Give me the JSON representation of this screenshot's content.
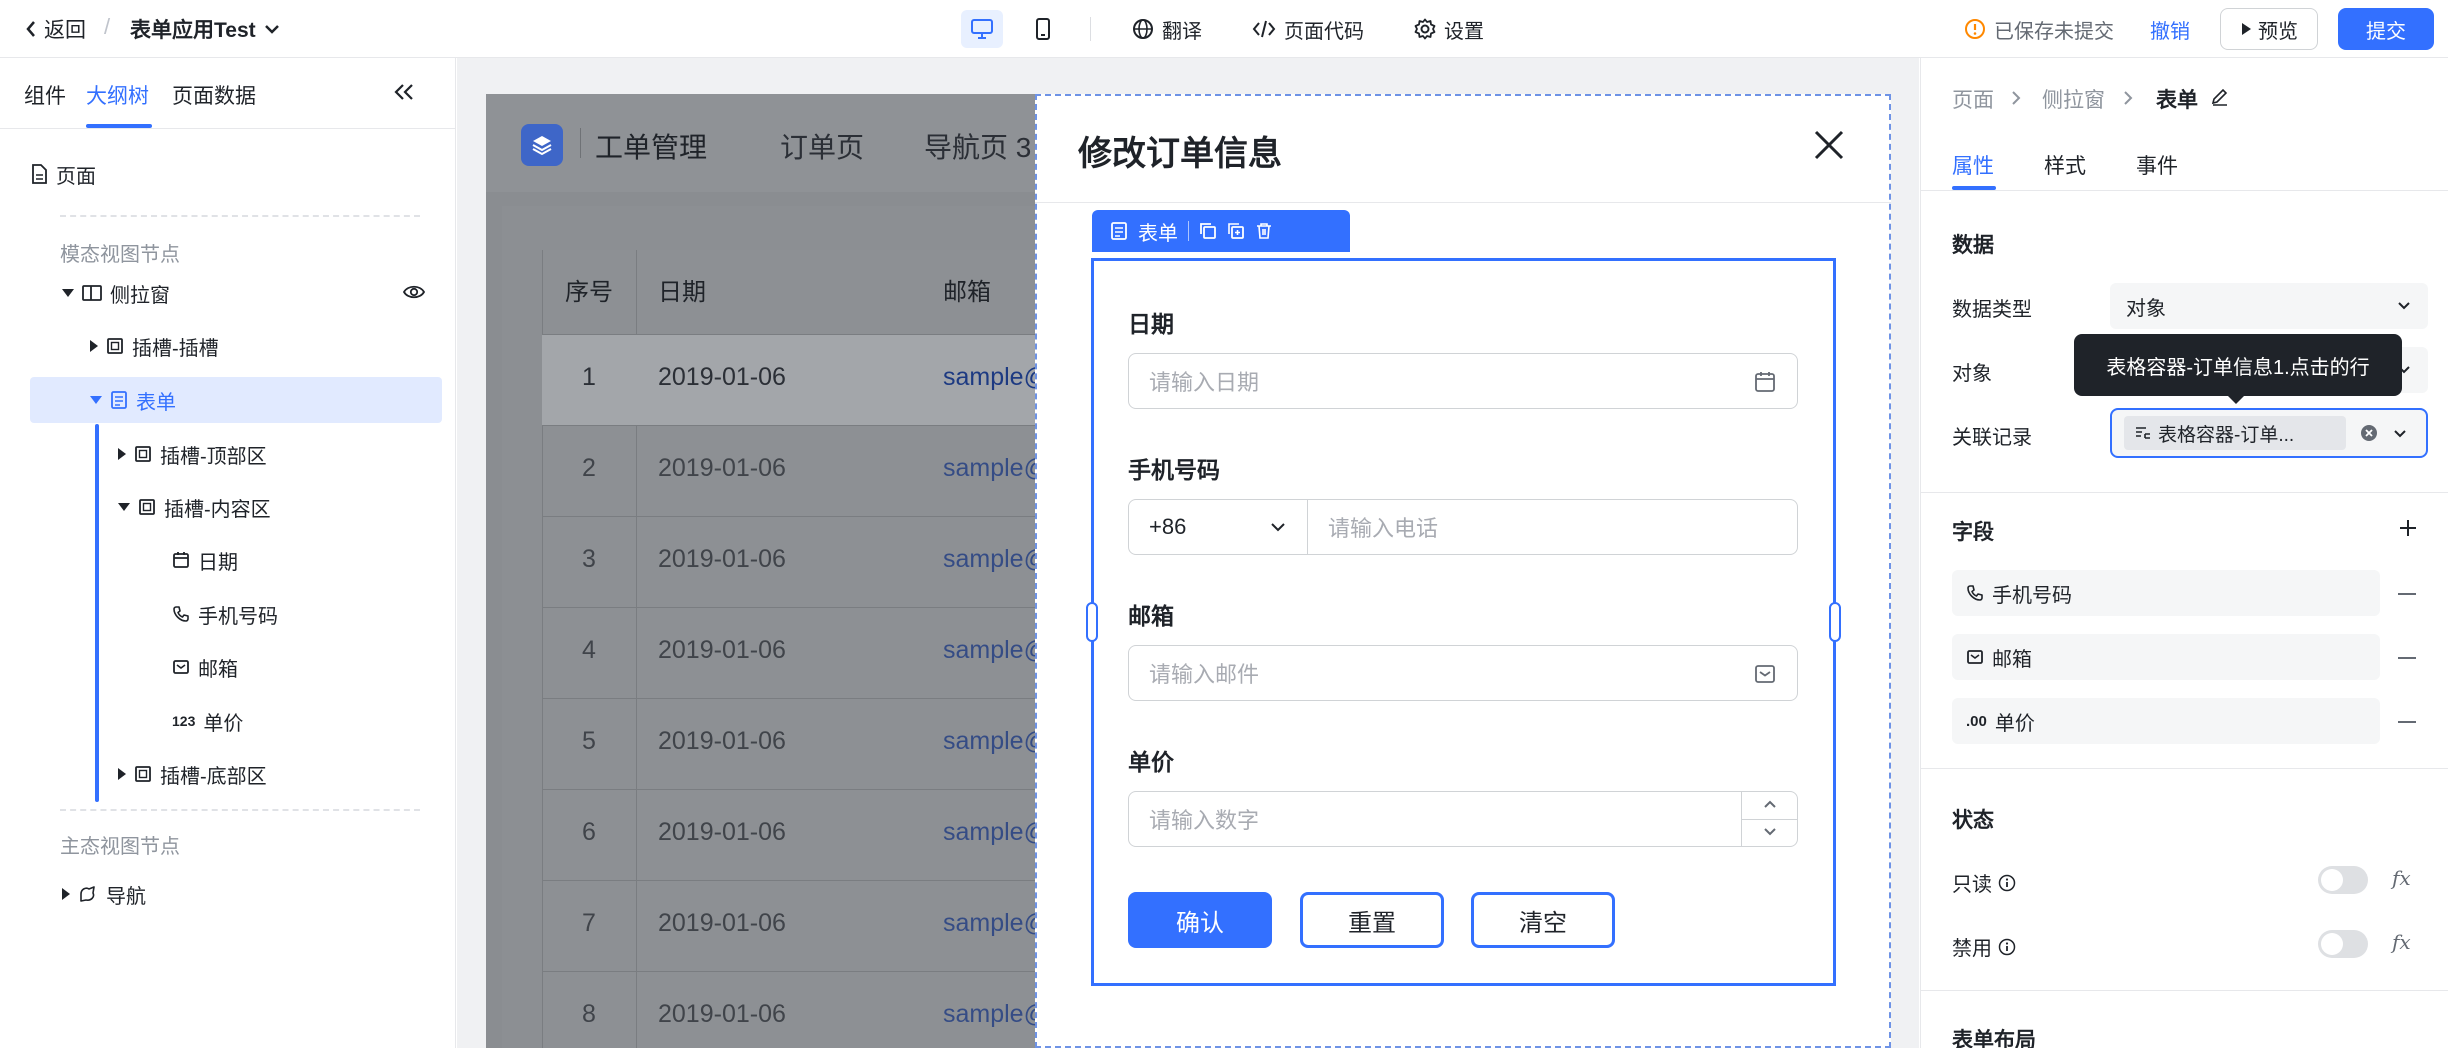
{
  "topbar": {
    "back_label": "返回",
    "separator": "/",
    "app_name": "表单应用Test",
    "tools": {
      "translate": "翻译",
      "page_code": "页面代码",
      "settings": "设置"
    },
    "status": "已保存未提交",
    "undo": "撤销",
    "preview": "预览",
    "submit": "提交"
  },
  "left": {
    "tabs": [
      "组件",
      "大纲树",
      "页面数据"
    ],
    "active_tab": "大纲树",
    "tree": {
      "page": "页面",
      "modal_section": "模态视图节点",
      "drawer": "侧拉窗",
      "slot_slot": "插槽-插槽",
      "form": "表单",
      "slot_top": "插槽-顶部区",
      "slot_content": "插槽-内容区",
      "date": "日期",
      "phone": "手机号码",
      "email": "邮箱",
      "price_prefix": "123",
      "price": "单价",
      "slot_bottom": "插槽-底部区",
      "main_section": "主态视图节点",
      "nav": "导航"
    }
  },
  "preview": {
    "app_title": "工单管理",
    "nav": [
      "订单页",
      "导航页 3"
    ],
    "columns": [
      "序号",
      "日期",
      "邮箱"
    ],
    "rows": [
      {
        "idx": "1",
        "date": "2019-01-06",
        "email": "sample@"
      },
      {
        "idx": "2",
        "date": "2019-01-06",
        "email": "sample@"
      },
      {
        "idx": "3",
        "date": "2019-01-06",
        "email": "sample@"
      },
      {
        "idx": "4",
        "date": "2019-01-06",
        "email": "sample@"
      },
      {
        "idx": "5",
        "date": "2019-01-06",
        "email": "sample@"
      },
      {
        "idx": "6",
        "date": "2019-01-06",
        "email": "sample@"
      },
      {
        "idx": "7",
        "date": "2019-01-06",
        "email": "sample@"
      },
      {
        "idx": "8",
        "date": "2019-01-06",
        "email": "sample@"
      }
    ]
  },
  "modal": {
    "title": "修改订单信息",
    "toolbar_label": "表单",
    "fields": {
      "date_label": "日期",
      "date_placeholder": "请输入日期",
      "phone_label": "手机号码",
      "phone_cc": "+86",
      "phone_placeholder": "请输入电话",
      "email_label": "邮箱",
      "email_placeholder": "请输入邮件",
      "price_label": "单价",
      "price_placeholder": "请输入数字"
    },
    "buttons": {
      "confirm": "确认",
      "reset": "重置",
      "clear": "清空"
    }
  },
  "right": {
    "breadcrumb": [
      "页面",
      "侧拉窗",
      "表单"
    ],
    "tabs": [
      "属性",
      "样式",
      "事件"
    ],
    "active_tab": "属性",
    "data_section": "数据",
    "data_type_label": "数据类型",
    "data_type_value": "对象",
    "object_label": "对象",
    "tooltip": "表格容器-订单信息1.点击的行",
    "record_label": "关联记录",
    "record_tag": "表格容器-订单...",
    "fields_section": "字段",
    "field_items": [
      "手机号码",
      "邮箱",
      "单价"
    ],
    "price_prefix": ".00",
    "status_section": "状态",
    "readonly_label": "只读",
    "disabled_label": "禁用",
    "fx": "fx",
    "layout_section": "表单布局"
  },
  "colors": {
    "accent": "#3370ff",
    "tooltip_bg": "#1f2329",
    "selected_bg": "#e1eaff"
  }
}
